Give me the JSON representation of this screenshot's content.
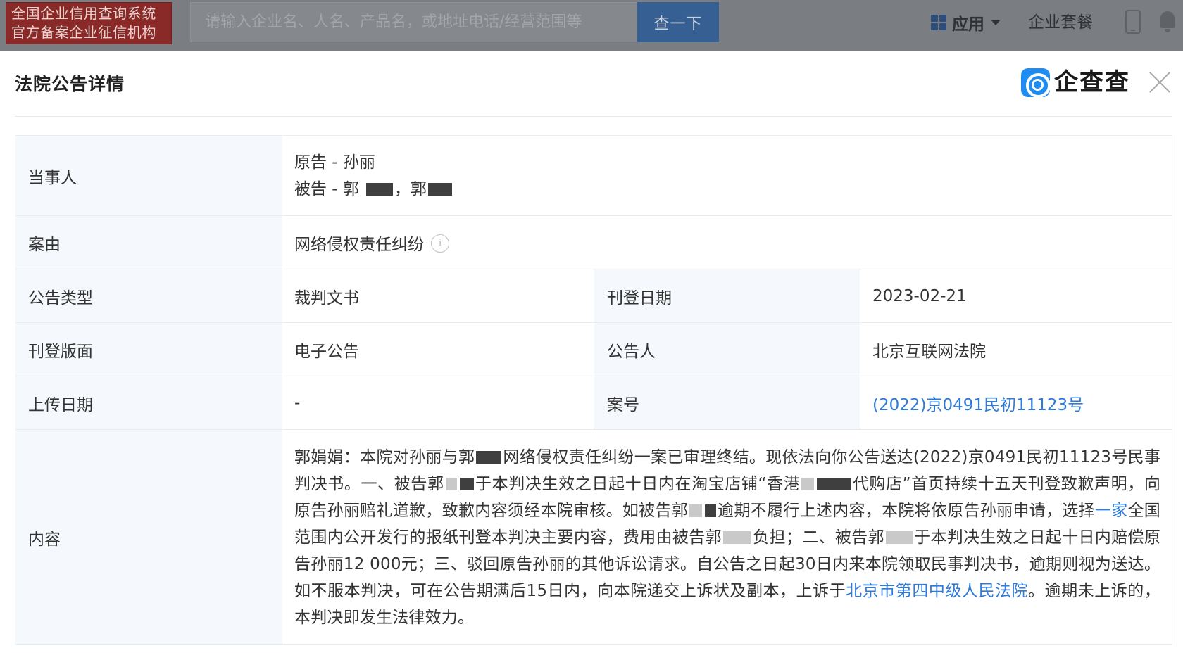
{
  "topbar": {
    "brand_line1": "全国企业信用查询系统",
    "brand_line2": "官方备案企业征信机构",
    "search_placeholder": "请输入企业名、人名、产品名，或地址电话/经营范围等",
    "search_button": "查一下",
    "apps_label": "应用",
    "enterprise_plan": "企业套餐"
  },
  "modal": {
    "title": "法院公告详情",
    "logo_text": "企查查"
  },
  "details": {
    "party_label": "当事人",
    "plaintiff": "原告 - 孙丽",
    "defendant_prefix": "被告 - 郭",
    "defendant_sep": "，郭",
    "cause_label": "案由",
    "cause_value": "网络侵权责任纠纷",
    "type_label": "公告类型",
    "type_value": "裁判文书",
    "pubdate_label": "刊登日期",
    "pubdate_value": "2023-02-21",
    "section_label": "刊登版面",
    "section_value": "电子公告",
    "announcer_label": "公告人",
    "announcer_value": "北京互联网法院",
    "upload_label": "上传日期",
    "upload_value": "-",
    "caseno_label": "案号",
    "caseno_value": "(2022)京0491民初11123号",
    "content_label": "内容",
    "content": {
      "p1": "郭娟娟：本院对孙丽与郭",
      "p2": "网络侵权责任纠纷一案已审理终结。现依法向你公告送达(2022)京0491民初11123号民事判决书。一、被告郭",
      "p3": "于本判决生效之日起十日内在淘宝店铺“香港",
      "p4": "代购店”首页持续十五天刊登致歉声明，向原告孙丽赔礼道歉，致歉内容须经本院审核。如被告郭",
      "p5": "逾期不履行上述内容，本院将依原告孙丽申请，选择",
      "link1": "一家",
      "p6": "全国范围内公开发行的报纸刊登本判决主要内容，费用由被告郭",
      "p7": "负担；二、被告郭",
      "p8": "于本判决生效之日起十日内赔偿原告孙丽12 000元；三、驳回原告孙丽的其他诉讼请求。自公告之日起30日内来本院领取民事判决书，逾期则视为送达。如不服本判决，可在公告期满后15日内，向本院递交上诉状及副本，上诉于",
      "link2": "北京市第四中级人民法院",
      "p9": "。逾期未上诉的，本判决即发生法律效力。"
    }
  }
}
